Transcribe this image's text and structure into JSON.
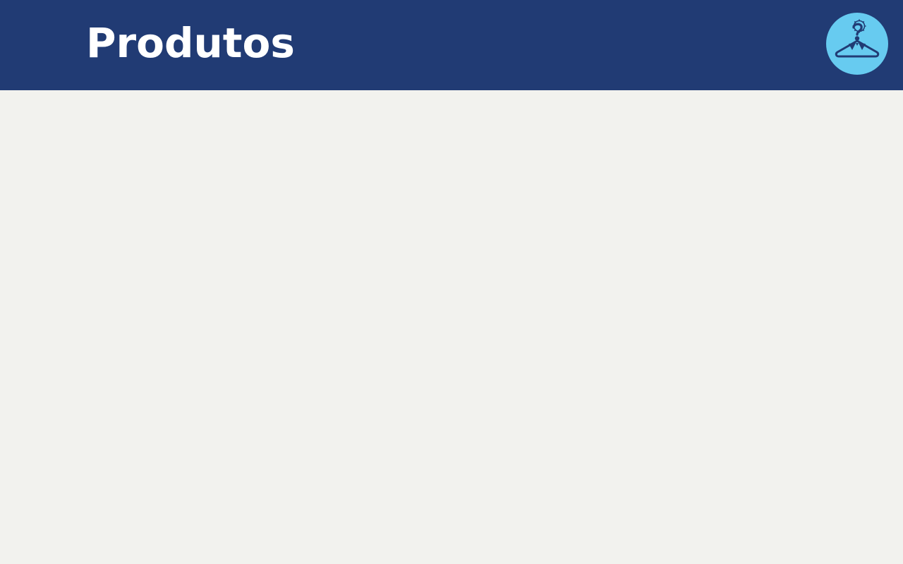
{
  "header": {
    "title": "Produtos",
    "logo_icon": "hanger-gear-question-icon"
  },
  "colors": {
    "header_bg": "#213B74",
    "title_text": "#FFFFFF",
    "logo_bg": "#67CBF0",
    "logo_fg": "#213B74",
    "page_bg": "#F2F2EE"
  }
}
